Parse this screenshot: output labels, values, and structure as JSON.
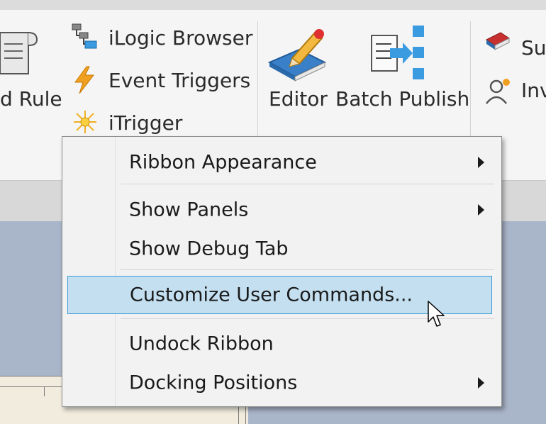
{
  "ribbon": {
    "partial_left_label": "d Rule",
    "ilogic_browser": "iLogic Browser",
    "event_triggers": "Event Triggers",
    "itrigger": "iTrigger",
    "editor": "Editor",
    "batch_publish": "Batch Publish",
    "partial_right_top": "Su",
    "partial_right_bottom": "Inv"
  },
  "context_menu": {
    "items": [
      {
        "label": "Ribbon Appearance",
        "submenu": true
      },
      {
        "label": "Show Panels",
        "submenu": true
      },
      {
        "label": "Show Debug Tab",
        "submenu": false
      },
      {
        "label": "Customize User Commands...",
        "submenu": false,
        "highlighted": true
      },
      {
        "label": "Undock Ribbon",
        "submenu": false
      },
      {
        "label": "Docking Positions",
        "submenu": true
      }
    ]
  },
  "colors": {
    "highlight_fill": "#c3dff0",
    "highlight_border": "#3e9bd6",
    "event_trigger_icon": "#f0a020",
    "batch_publish_icon": "#3a9be0"
  },
  "icons": {
    "rule": "scroll-icon",
    "ilogic_browser": "tree-browser-icon",
    "event_triggers": "lightning-icon",
    "itrigger": "sunburst-icon",
    "editor": "book-pencil-icon",
    "batch_publish": "batch-publish-icon",
    "su": "red-book-icon",
    "inv": "user-icon"
  }
}
